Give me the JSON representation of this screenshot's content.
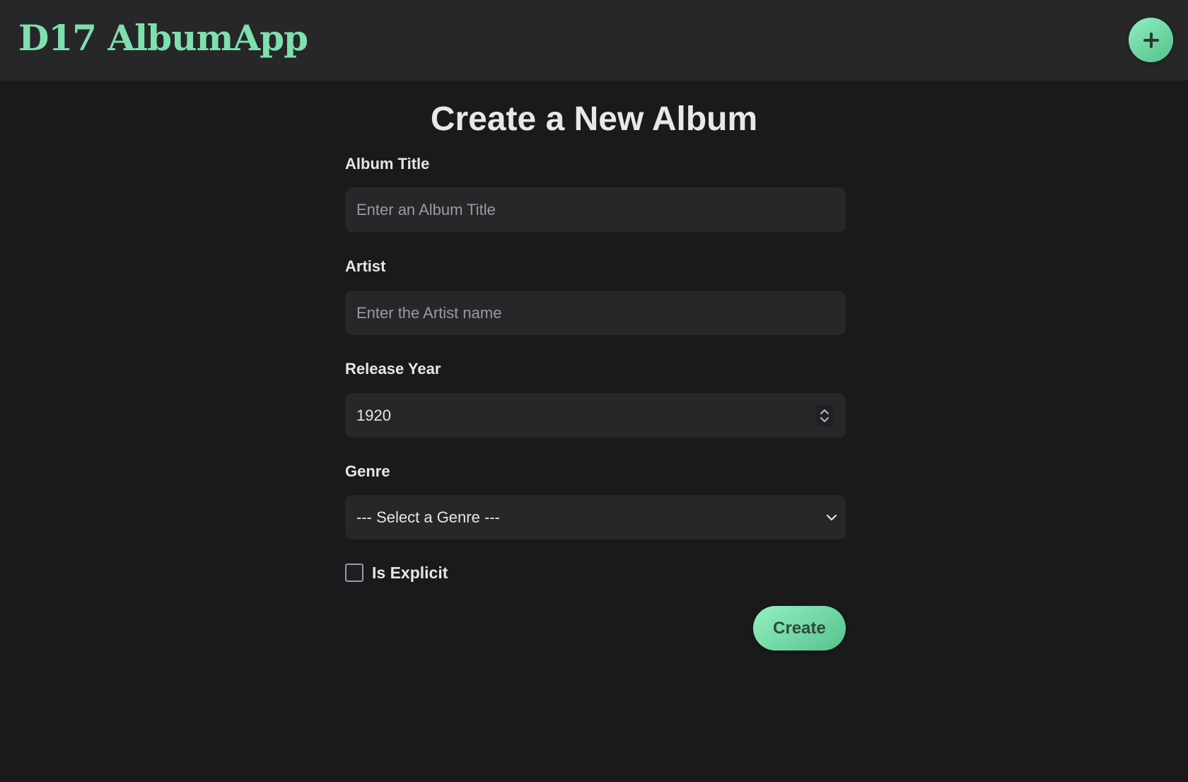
{
  "header": {
    "brand": "D17 AlbumApp",
    "add_icon": "plus-icon"
  },
  "main": {
    "title": "Create a New Album"
  },
  "form": {
    "album_title": {
      "label": "Album Title",
      "placeholder": "Enter an Album Title",
      "value": ""
    },
    "artist": {
      "label": "Artist",
      "placeholder": "Enter the Artist name",
      "value": ""
    },
    "release_year": {
      "label": "Release Year",
      "value": "1920"
    },
    "genre": {
      "label": "Genre",
      "selected": "--- Select a Genre ---"
    },
    "explicit": {
      "label": "Is Explicit",
      "checked": false
    },
    "submit_label": "Create"
  },
  "colors": {
    "accent": "#7ee0ad",
    "background": "#1a1a1c",
    "surface": "#27272a"
  }
}
